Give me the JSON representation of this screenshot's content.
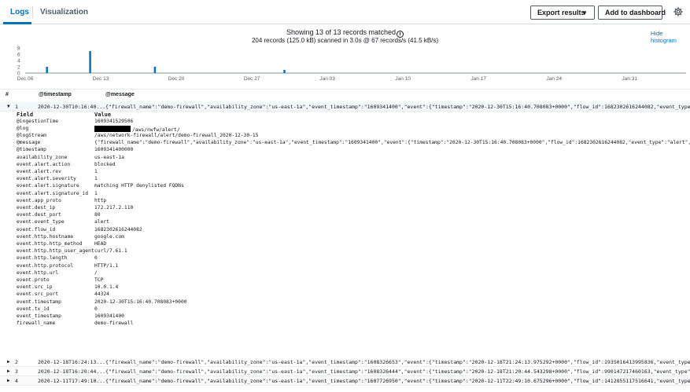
{
  "tabs": {
    "logs": "Logs",
    "visualization": "Visualization"
  },
  "toolbar": {
    "export_label": "Export results",
    "dashboard_label": "Add to dashboard",
    "settings_icon": "gear-icon"
  },
  "summary": {
    "line1": "Showing 13 of 13 records matched",
    "line2": "204 records (125.0 kB) scanned in 3.0s @ 67 records/s (41.5 kB/s)",
    "hide_histogram": "Hide histogram"
  },
  "chart_data": {
    "type": "bar",
    "y_ticks": [
      "8",
      "6",
      "4",
      "2",
      "0"
    ],
    "ylim": [
      0,
      8
    ],
    "x_labels": [
      "Dec 06",
      "Dec 13",
      "Dec 20",
      "Dec 27",
      "Jan 03",
      "Jan 10",
      "Jan 17",
      "Jan 24",
      "Jan 31"
    ],
    "bars": [
      {
        "date": "Dec 08",
        "value": 2
      },
      {
        "date": "Dec 12",
        "value": 7
      },
      {
        "date": "Dec 18",
        "value": 2
      },
      {
        "date": "Dec 30",
        "value": 1
      }
    ],
    "bar_color": "#0073bb"
  },
  "table": {
    "headers": {
      "hash": "#",
      "timestamp": "@timestamp",
      "message": "@message"
    },
    "expanded": {
      "num": "1",
      "timestamp": "2020-12-30T10:16:40...",
      "message": "{\"firewall_name\":\"demo-firewall\",\"availability_zone\":\"us-east-1a\",\"event_timestamp\":\"1609341400\",\"event\":{\"timestamp\":\"2020-12-30T15:16:40.708083+0000\",\"flow_id\":1682302616244082,\"event_type\":\"alert\",\"src_ip\":"
    },
    "field_header": "Field",
    "value_header": "Value",
    "fields": [
      {
        "k": "@ingestionTime",
        "v": "1609341529506"
      },
      {
        "k": "@log",
        "v": "/aws/nwfw/alert/"
      },
      {
        "k": "@logStream",
        "v": "/aws/network-firewall/alert/demo-firewall_2020-12-30-15"
      },
      {
        "k": "@message",
        "v": "{\"firewall_name\":\"demo-firewall\",\"availability_zone\":\"us-east-1a\",\"event_timestamp\":\"1609341400\",\"event\":{\"timestamp\":\"2020-12-30T15:16:40.708083+0000\",\"flow_id\":1682302616244082,\"event_type\":\"alert\",\"src_ip\":"
      },
      {
        "k": "@timestamp",
        "v": "1609341400000"
      },
      {
        "k": "availability_zone",
        "v": "us-east-1a"
      },
      {
        "k": "event.alert.action",
        "v": "blocked"
      },
      {
        "k": "event.alert.rev",
        "v": "1"
      },
      {
        "k": "event.alert.severity",
        "v": "1"
      },
      {
        "k": "event.alert.signature",
        "v": "matching HTTP denylisted FQDNs"
      },
      {
        "k": "event.alert.signature_id",
        "v": "1"
      },
      {
        "k": "event.app_proto",
        "v": "http"
      },
      {
        "k": "event.dest_ip",
        "v": "172.217.2.110"
      },
      {
        "k": "event.dest_port",
        "v": "80"
      },
      {
        "k": "event.event_type",
        "v": "alert"
      },
      {
        "k": "event.flow_id",
        "v": "1682302616244082"
      },
      {
        "k": "event.http.hostname",
        "v": "google.com"
      },
      {
        "k": "event.http.http_method",
        "v": "HEAD"
      },
      {
        "k": "event.http.http_user_agent",
        "v": "curl/7.61.1"
      },
      {
        "k": "event.http.length",
        "v": "0"
      },
      {
        "k": "event.http.protocol",
        "v": "HTTP/1.1"
      },
      {
        "k": "event.http.url",
        "v": "/"
      },
      {
        "k": "event.proto",
        "v": "TCP"
      },
      {
        "k": "event.src_ip",
        "v": "10.0.1.4"
      },
      {
        "k": "event.src_port",
        "v": "44324"
      },
      {
        "k": "event.timestamp",
        "v": "2020-12-30T15:16:40.708083+0000"
      },
      {
        "k": "event.tx_id",
        "v": "0"
      },
      {
        "k": "event_timestamp",
        "v": "1609341400"
      },
      {
        "k": "firewall_name",
        "v": "demo-firewall"
      }
    ],
    "rows": [
      {
        "num": "2",
        "timestamp": "2020-12-18T16:24:13...",
        "message": "{\"firewall_name\":\"demo-firewall\",\"availability_zone\":\"us-east-1a\",\"event_timestamp\":\"1608326653\",\"event\":{\"timestamp\":\"2020-12-18T21:24:13.975292+0000\",\"flow_id\":1935016413995836,\"event_type\":\"alert\",\"src_ip\":"
      },
      {
        "num": "3",
        "timestamp": "2020-12-18T16:20:44...",
        "message": "{\"firewall_name\":\"demo-firewall\",\"availability_zone\":\"us-east-1a\",\"event_timestamp\":\"1608326444\",\"event\":{\"timestamp\":\"2020-12-18T21:20:44.543298+0000\",\"flow_id\":990147217460163,\"event_type\":\"alert\",\"src_ip\":"
      },
      {
        "num": "4",
        "timestamp": "2020-12-11T17:49:10...",
        "message": "{\"firewall_name\":\"demo-firewall\",\"availability_zone\":\"us-east-1a\",\"event_timestamp\":\"1607726950\",\"event\":{\"timestamp\":\"2020-12-11T22:49:10.675296+0000\",\"flow_id\":1412855117516641,\"event_type\":\"alert\",\"src_ip\":"
      }
    ]
  }
}
